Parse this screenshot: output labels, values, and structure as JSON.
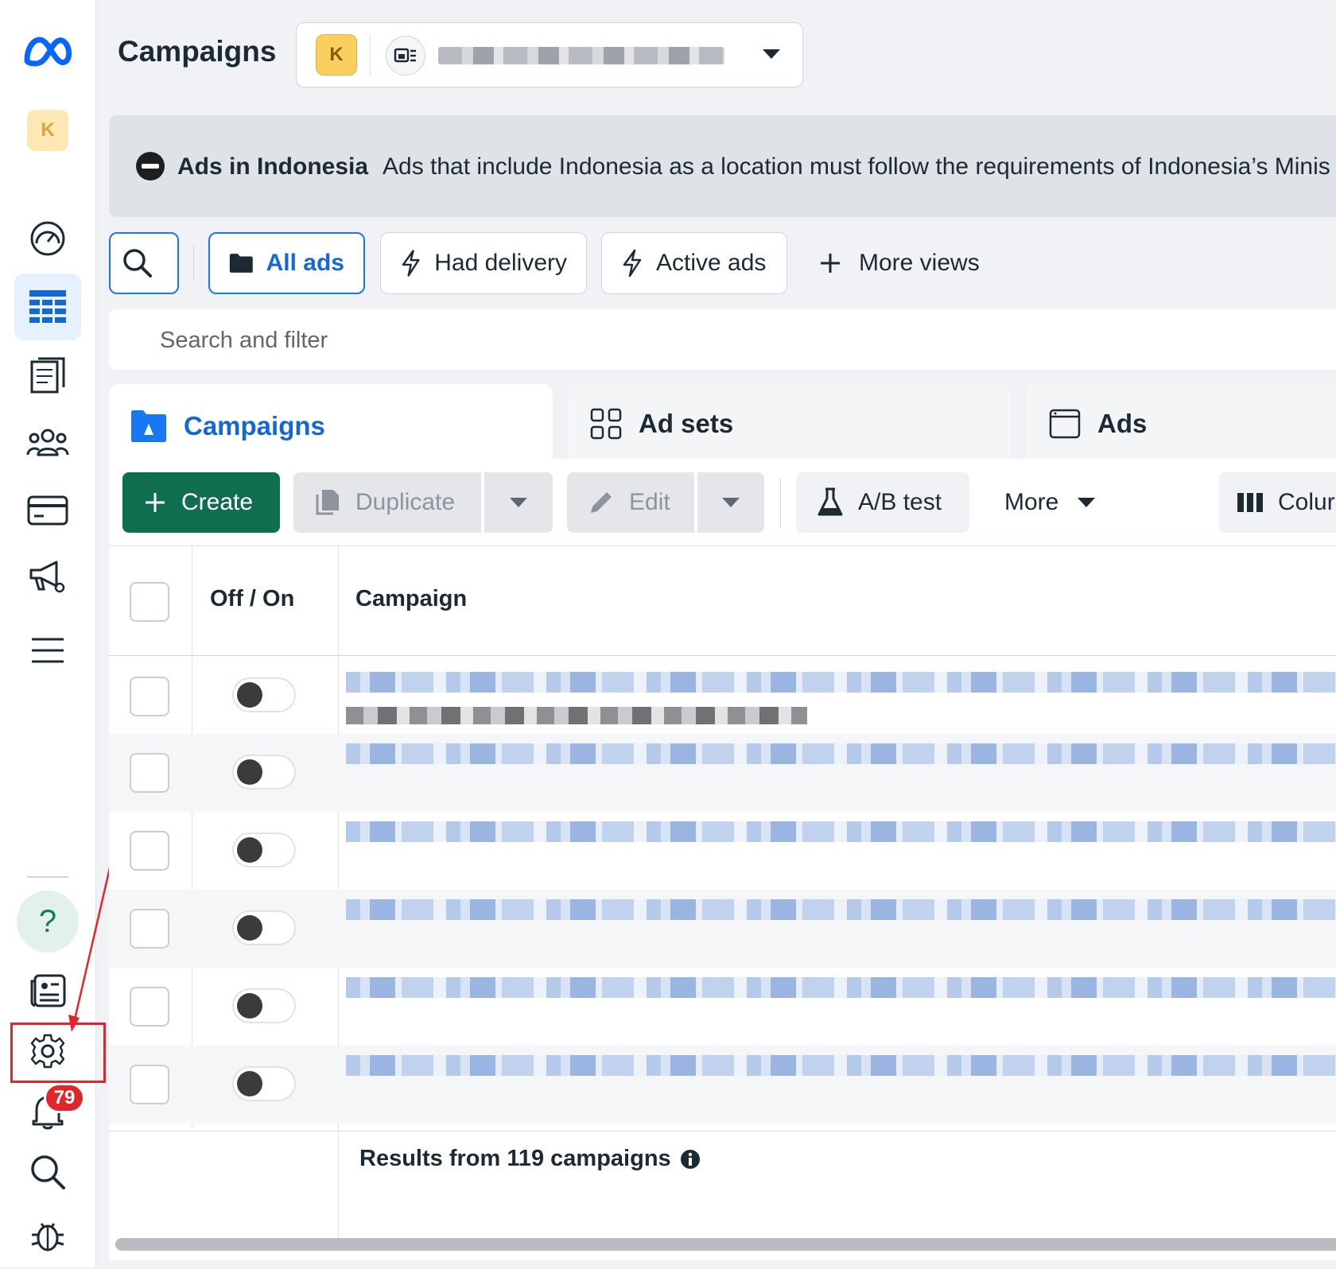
{
  "header": {
    "title": "Campaigns",
    "account_initial": "K"
  },
  "sidebar": {
    "account_initial": "K",
    "help_label": "?",
    "notifications_count": "79",
    "items": [
      {
        "icon": "dashboard-gauge-icon"
      },
      {
        "icon": "campaigns-table-icon",
        "active": true
      },
      {
        "icon": "pages-icon"
      },
      {
        "icon": "audiences-icon"
      },
      {
        "icon": "billing-card-icon"
      },
      {
        "icon": "ads-manager-megaphone-icon"
      },
      {
        "icon": "all-tools-menu-icon"
      }
    ]
  },
  "banner": {
    "title": "Ads in Indonesia",
    "text": "Ads that include Indonesia as a location must follow the requirements of Indonesia’s Minis"
  },
  "views": {
    "all_ads": "All ads",
    "had_delivery": "Had delivery",
    "active_ads": "Active ads",
    "more_views": "More views"
  },
  "filter": {
    "placeholder": "Search and filter"
  },
  "level_tabs": {
    "campaigns": "Campaigns",
    "ad_sets": "Ad sets",
    "ads": "Ads"
  },
  "toolbar": {
    "create": "Create",
    "duplicate": "Duplicate",
    "edit": "Edit",
    "ab_test": "A/B test",
    "more": "More",
    "columns": "Colur"
  },
  "table": {
    "headers": {
      "off_on": "Off / On",
      "campaign": "Campaign"
    },
    "row_count_visible": 6,
    "footer": "Results from 119 campaigns"
  },
  "colors": {
    "accent_blue": "#1877f2",
    "create_green": "#0f6e4f",
    "badge_red": "#e0262b",
    "annotation_red": "#e3242b"
  }
}
